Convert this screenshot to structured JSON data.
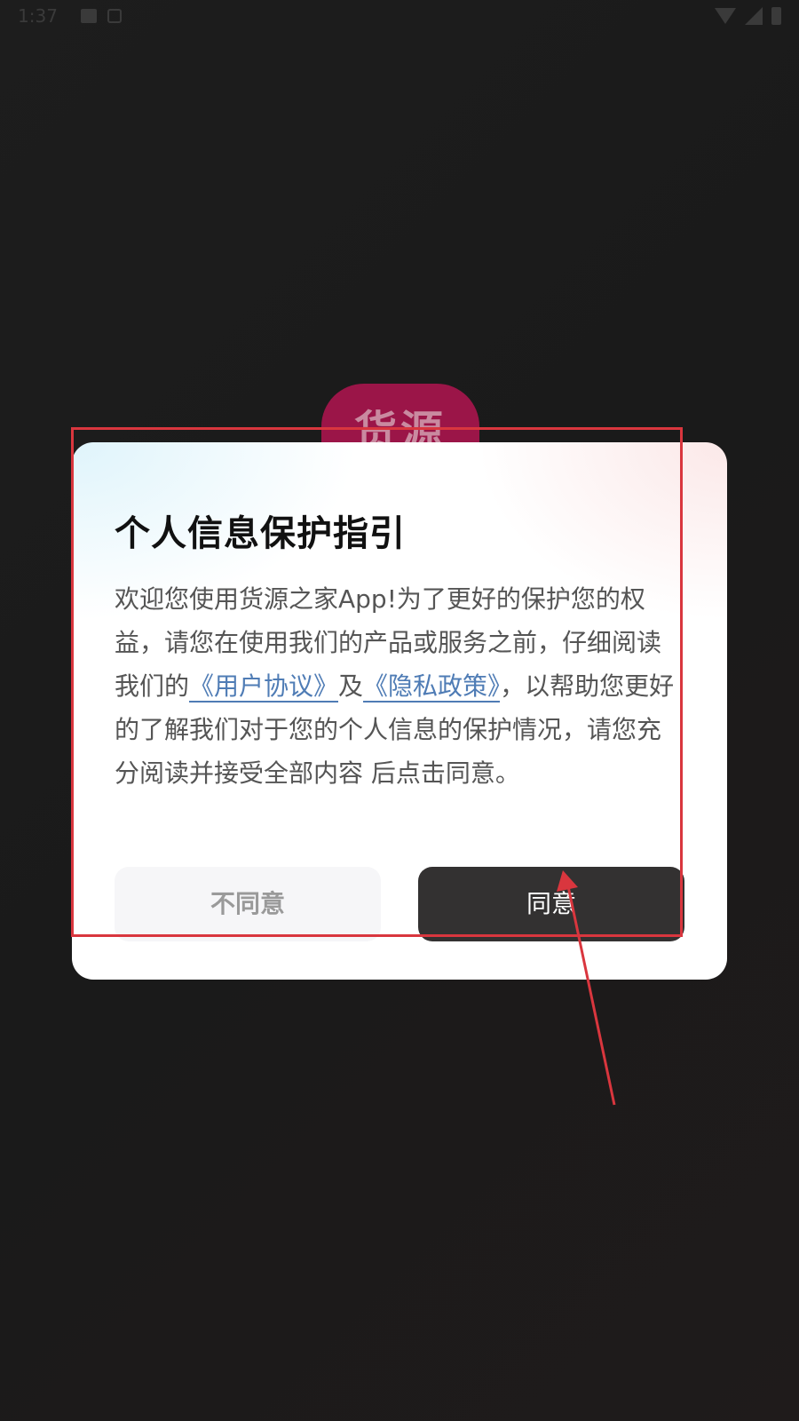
{
  "status_bar": {
    "time": "1:37"
  },
  "background_app": {
    "logo_text": "货源"
  },
  "dialog": {
    "title": "个人信息保护指引",
    "body_part1": "欢迎您使用货源之家App!为了更好的保护您的权益，请您在使用我们的产品或服务之前，仔细阅读我们的",
    "user_agreement_link": "《用户协议》",
    "and_text": "及",
    "privacy_policy_link": "《隐私政策》",
    "body_part2": "，以帮助您更好的了解我们对于您的个人信息的保护情况，请您充分阅读并接受全部内容 后点击同意。",
    "disagree_label": "不同意",
    "agree_label": "同意"
  },
  "colors": {
    "link": "#4f7cb5",
    "agree_button": "#333131",
    "annotation": "#d9363e"
  }
}
